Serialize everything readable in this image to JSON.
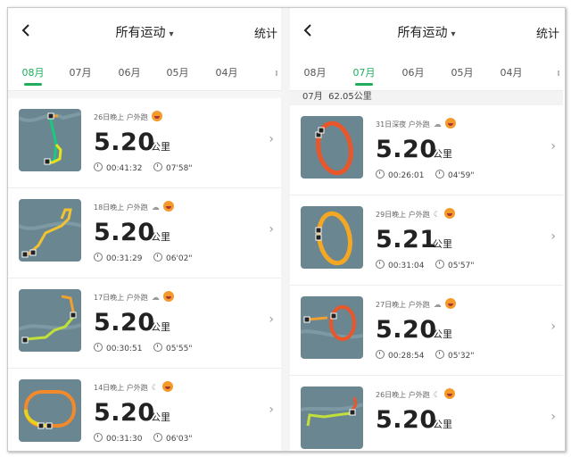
{
  "left": {
    "header": {
      "title": "所有运动",
      "stats_label": "统计"
    },
    "tabs": [
      {
        "label": "08月",
        "active": true
      },
      {
        "label": "07月",
        "active": false
      },
      {
        "label": "06月",
        "active": false
      },
      {
        "label": "05月",
        "active": false
      },
      {
        "label": "04月",
        "active": false
      }
    ],
    "items": [
      {
        "date": "26日晚上",
        "type": "户外跑",
        "weather": "",
        "distance": "5.20",
        "unit": "公里",
        "duration": "00:41:32",
        "pace": "07'58\""
      },
      {
        "date": "18日晚上",
        "type": "户外跑",
        "weather": "cloud-icon",
        "distance": "5.20",
        "unit": "公里",
        "duration": "00:31:29",
        "pace": "06'02\""
      },
      {
        "date": "17日晚上",
        "type": "户外跑",
        "weather": "cloud-icon",
        "distance": "5.20",
        "unit": "公里",
        "duration": "00:30:51",
        "pace": "05'55\""
      },
      {
        "date": "14日晚上",
        "type": "户外跑",
        "weather": "moon-icon",
        "distance": "5.20",
        "unit": "公里",
        "duration": "00:31:30",
        "pace": "06'03\""
      }
    ]
  },
  "right": {
    "header": {
      "title": "所有运动",
      "stats_label": "统计"
    },
    "tabs": [
      {
        "label": "08月",
        "active": false
      },
      {
        "label": "07月",
        "active": true
      },
      {
        "label": "06月",
        "active": false
      },
      {
        "label": "05月",
        "active": false
      },
      {
        "label": "04月",
        "active": false
      }
    ],
    "summary": {
      "month": "07月",
      "total": "62.05公里"
    },
    "items": [
      {
        "date": "31日深夜",
        "type": "户外跑",
        "weather": "cloud-icon",
        "distance": "5.20",
        "unit": "公里",
        "duration": "00:26:01",
        "pace": "04'59\""
      },
      {
        "date": "29日晚上",
        "type": "户外跑",
        "weather": "moon-icon",
        "distance": "5.21",
        "unit": "公里",
        "duration": "00:31:04",
        "pace": "05'57\""
      },
      {
        "date": "27日晚上",
        "type": "户外跑",
        "weather": "cloud-icon",
        "distance": "5.20",
        "unit": "公里",
        "duration": "00:28:54",
        "pace": "05'32\""
      },
      {
        "date": "26日晚上",
        "type": "户外跑",
        "weather": "moon-icon",
        "distance": "5.20",
        "unit": "公里",
        "duration": "",
        "pace": ""
      }
    ]
  },
  "colors": {
    "accent": "#1fae5e",
    "map": "#6a8791"
  }
}
